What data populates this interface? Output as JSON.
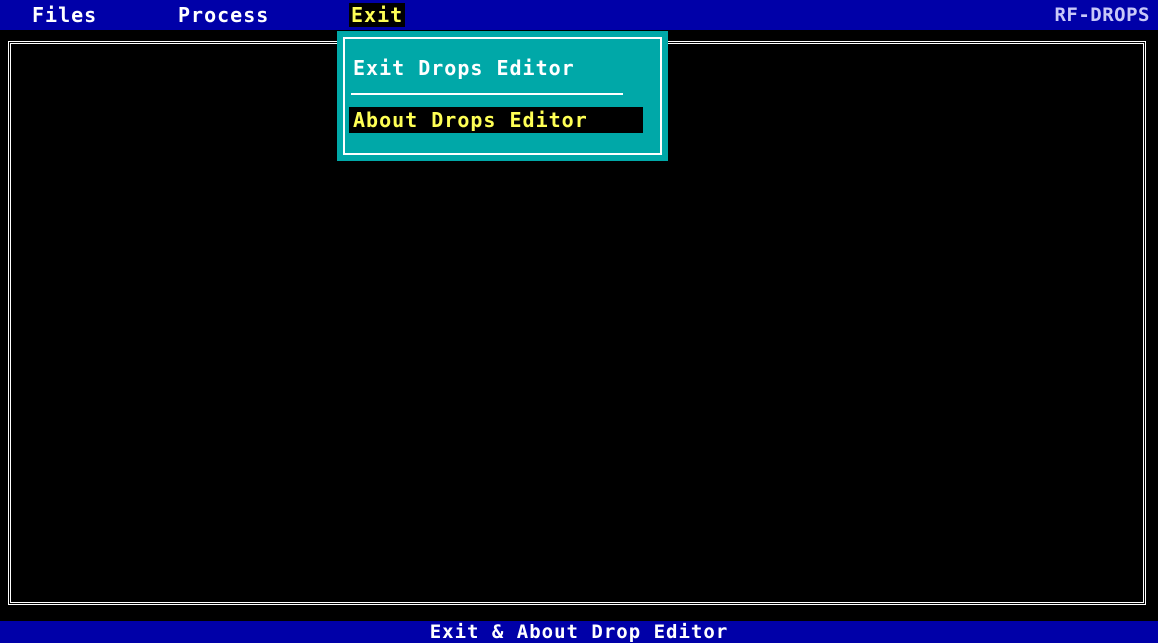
{
  "menubar": {
    "items": [
      {
        "label": "Files"
      },
      {
        "label": "Process"
      },
      {
        "label": "Exit",
        "active": true
      }
    ],
    "app_title": "RF-DROPS"
  },
  "exit_menu": {
    "items": [
      {
        "label": "Exit Drops Editor"
      },
      {
        "label": "About Drops Editor",
        "selected": true
      }
    ]
  },
  "statusbar": {
    "text": "Exit & About Drop Editor"
  },
  "colors": {
    "menubar_bg": "#0000a8",
    "menu_bg": "#00a8a8",
    "highlight_text": "#ffff55",
    "screen_bg": "#000000"
  }
}
